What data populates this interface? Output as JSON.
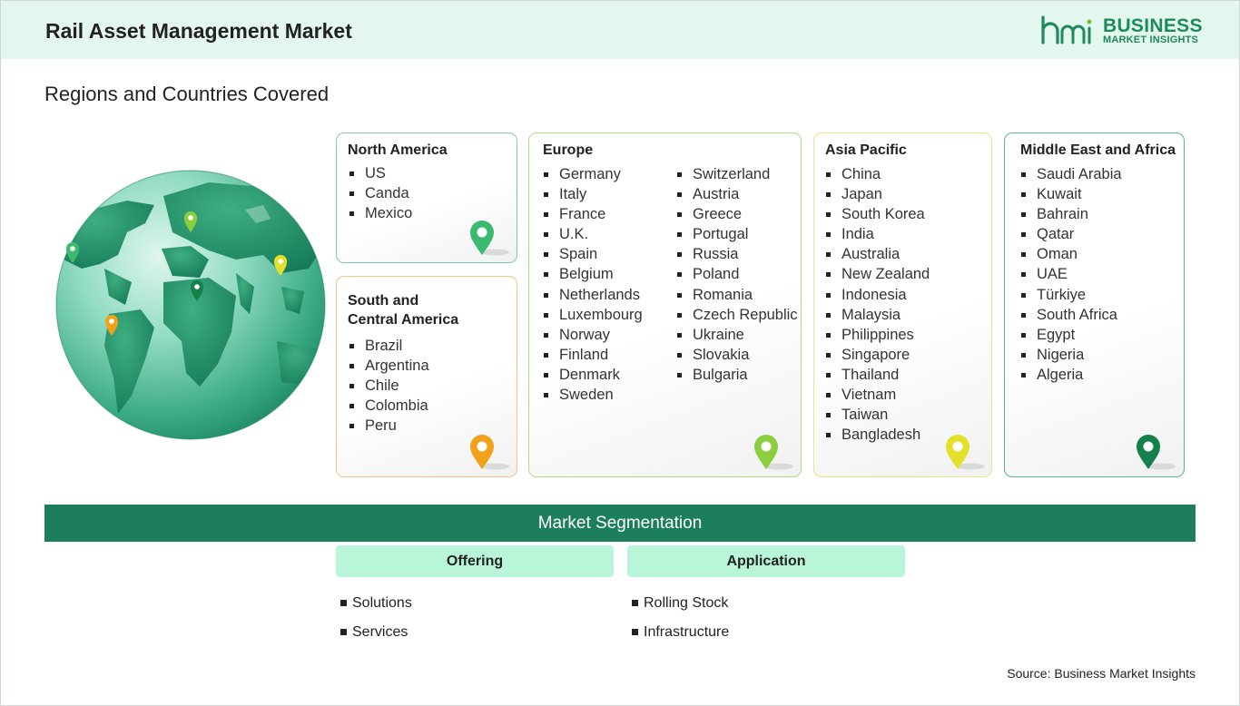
{
  "header": {
    "title": "Rail Asset Management Market",
    "logo": {
      "mark": "bmi",
      "brand": "BUSINESS",
      "tagline": "MARKET INSIGHTS",
      "color": "#1d8a5f"
    }
  },
  "subtitle": "Regions and Countries Covered",
  "regions": {
    "north_america": {
      "title": "North America",
      "countries": [
        "US",
        "Canda",
        "Mexico"
      ],
      "pin_color": "#3cba6f"
    },
    "south_america": {
      "title_line1": "South and",
      "title_line2": "Central America",
      "countries": [
        "Brazil",
        "Argentina",
        "Chile",
        "Colombia",
        "Peru"
      ],
      "pin_color": "#f2a11a"
    },
    "europe": {
      "title": "Europe",
      "countries_col1": [
        "Germany",
        "Italy",
        "France",
        "U.K.",
        "Spain",
        "Belgium",
        "Netherlands",
        "Luxembourg",
        "Norway",
        "Finland",
        "Denmark",
        "Sweden"
      ],
      "countries_col2": [
        "Switzerland",
        "Austria",
        "Greece",
        "Portugal",
        "Russia",
        "Poland",
        "Romania",
        "Czech Republic",
        "Ukraine",
        "Slovakia",
        "Bulgaria"
      ],
      "pin_color": "#8ccf3e"
    },
    "asia_pacific": {
      "title": "Asia Pacific",
      "countries": [
        "China",
        "Japan",
        "South Korea",
        "India",
        "Australia",
        "New Zealand",
        "Indonesia",
        "Malaysia",
        "Philippines",
        "Singapore",
        "Thailand",
        "Vietnam",
        "Taiwan",
        "Bangladesh"
      ],
      "pin_color": "#e4e02a"
    },
    "middle_east_africa": {
      "title": "Middle East and Africa",
      "countries": [
        "Saudi Arabia",
        "Kuwait",
        "Bahrain",
        "Qatar",
        "Oman",
        "UAE",
        "Türkiye",
        "South Africa",
        "Egypt",
        "Nigeria",
        "Algeria"
      ],
      "pin_color": "#14804a"
    }
  },
  "segmentation": {
    "title": "Market Segmentation",
    "offering": {
      "label": "Offering",
      "items": [
        "Solutions",
        "Services"
      ]
    },
    "application": {
      "label": "Application",
      "items": [
        "Rolling Stock",
        "Infrastructure"
      ]
    }
  },
  "source": "Source: Business Market Insights"
}
